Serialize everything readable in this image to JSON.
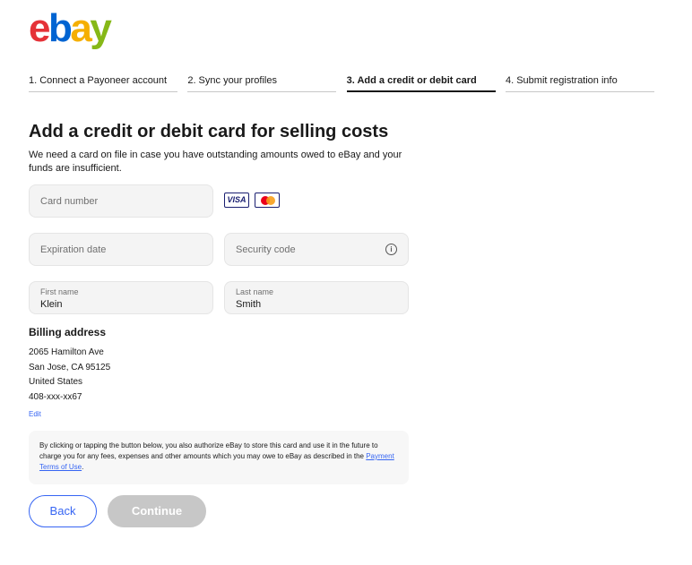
{
  "logo": {
    "e": "e",
    "b": "b",
    "a": "a",
    "y": "y"
  },
  "steps": [
    {
      "label": "1. Connect a Payoneer account"
    },
    {
      "label": "2. Sync your profiles"
    },
    {
      "label": "3. Add a credit or debit card"
    },
    {
      "label": "4. Submit registration info"
    }
  ],
  "active_step": 3,
  "page": {
    "title": "Add a credit or debit card for selling costs",
    "description": "We need a card on file in case you have outstanding amounts owed to eBay and your funds are insufficient."
  },
  "form": {
    "card_number_placeholder": "Card number",
    "expiration_placeholder": "Expiration date",
    "security_code_placeholder": "Security code",
    "first_name_label": "First name",
    "first_name_value": "Klein",
    "last_name_label": "Last name",
    "last_name_value": "Smith"
  },
  "cards": {
    "visa": "VISA"
  },
  "billing": {
    "heading": "Billing address",
    "lines": [
      "2065 Hamilton Ave",
      "San Jose, CA 95125",
      "United States",
      "408-xxx-xx67"
    ],
    "edit": "Edit"
  },
  "notice": {
    "text": "By clicking or tapping the button below, you also authorize eBay to store this card and use it in the future to charge you for any fees, expenses and other amounts which you may owe to eBay as described in the ",
    "link": "Payment Terms of Use",
    "end": "."
  },
  "buttons": {
    "back": "Back",
    "continue": "Continue"
  },
  "colors": {
    "accent": "#3665f3",
    "disabled": "#c7c7c7"
  }
}
